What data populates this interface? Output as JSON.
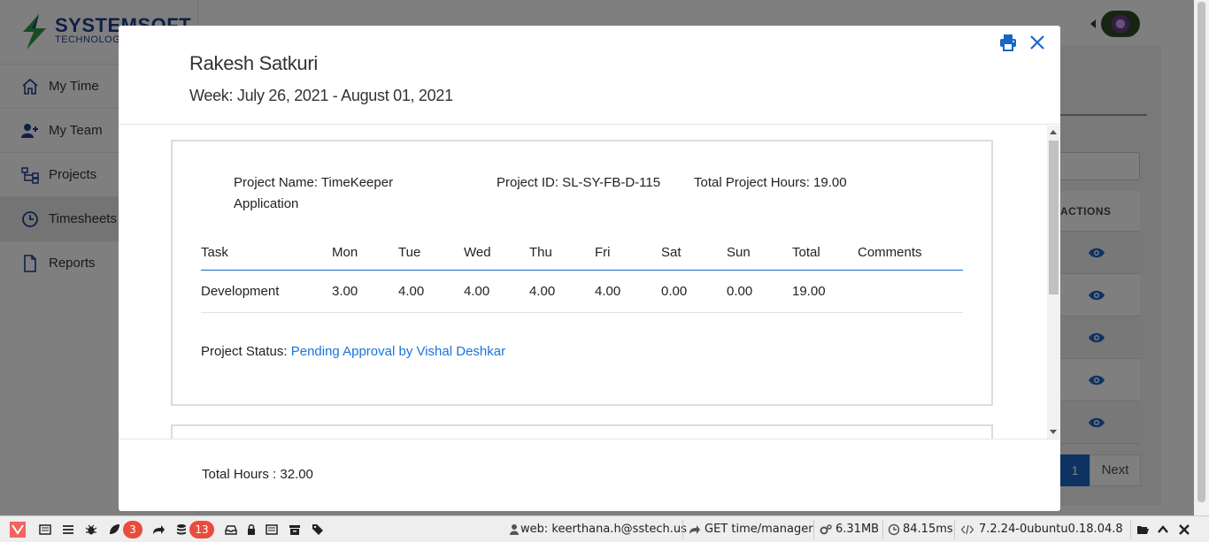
{
  "app": {
    "brand": "SYSTEMSOFT",
    "brand_sub": "TECHNOLOGIES",
    "nav": [
      {
        "label": "My Time",
        "icon": "home-icon"
      },
      {
        "label": "My Team",
        "icon": "user-plus-icon"
      },
      {
        "label": "Projects",
        "icon": "sitemap-icon"
      },
      {
        "label": "Timesheets",
        "icon": "clock-icon"
      },
      {
        "label": "Reports",
        "icon": "file-icon"
      }
    ],
    "active_nav": "Timesheets",
    "table_header": "ACTIONS",
    "pagination": {
      "current": "1",
      "next": "Next"
    }
  },
  "modal": {
    "employee_name": "Rakesh Satkuri",
    "week": "Week: July 26, 2021 - August 01, 2021",
    "project": {
      "name": "Project Name: TimeKeeper Application",
      "id": "Project ID: SL-SY-FB-D-115",
      "total_hours": "Total Project Hours: 19.00"
    },
    "table": {
      "headers": [
        "Task",
        "Mon",
        "Tue",
        "Wed",
        "Thu",
        "Fri",
        "Sat",
        "Sun",
        "Total",
        "Comments"
      ],
      "rows": [
        [
          "Development",
          "3.00",
          "4.00",
          "4.00",
          "4.00",
          "4.00",
          "0.00",
          "0.00",
          "19.00",
          ""
        ]
      ]
    },
    "status_label": "Project Status:",
    "status_value": "Pending Approval by Vishal Deshkar",
    "total_hours": "Total Hours : 32.00"
  },
  "debugbar": {
    "badge_a": "3",
    "badge_b": "13",
    "user": "web: keerthana.h@sstech.us",
    "route": "GET time/manager",
    "memory": "6.31MB",
    "time": "84.15ms",
    "php": "7.2.24-0ubuntu0.18.04.8"
  },
  "colors": {
    "accent": "#1a66c4",
    "link": "#1a73d9",
    "badge": "#e74c3c"
  }
}
